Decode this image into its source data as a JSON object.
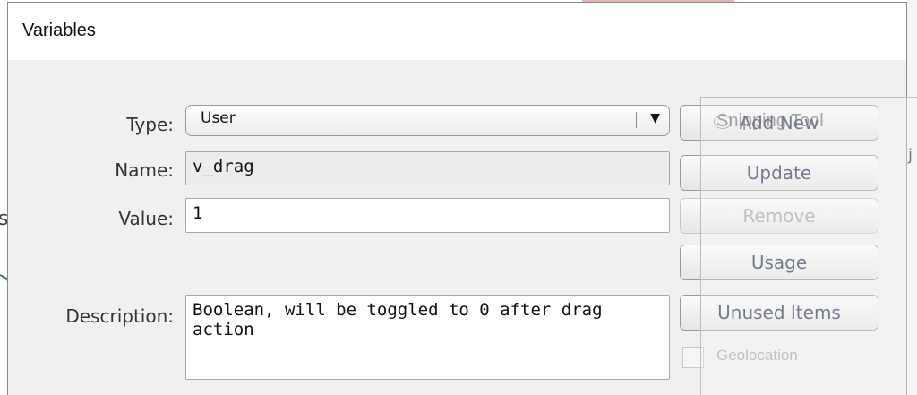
{
  "dialog": {
    "title": "Variables"
  },
  "form": {
    "type": {
      "label": "Type:",
      "value": "User"
    },
    "name": {
      "label": "Name:",
      "value": "v_drag"
    },
    "value": {
      "label": "Value:",
      "value": "1"
    },
    "description": {
      "label": "Description:",
      "value": "Boolean, will be toggled to 0 after drag action"
    }
  },
  "buttons": {
    "add_new": "Add New",
    "update": "Update",
    "remove": "Remove",
    "usage": "Usage",
    "unused_items": "Unused Items"
  },
  "geolocation": {
    "label": "Geolocation",
    "checked": false
  },
  "overlay": {
    "snipping_tool_title": "Snipping Tool"
  },
  "icons": {
    "dropdown": "triangle-down-icon",
    "snipping": "scissors-icon"
  },
  "colors": {
    "button_text": "#2f3b55",
    "disabled_text": "#a3a3a3",
    "dialog_bg": "#f0f0f0"
  }
}
